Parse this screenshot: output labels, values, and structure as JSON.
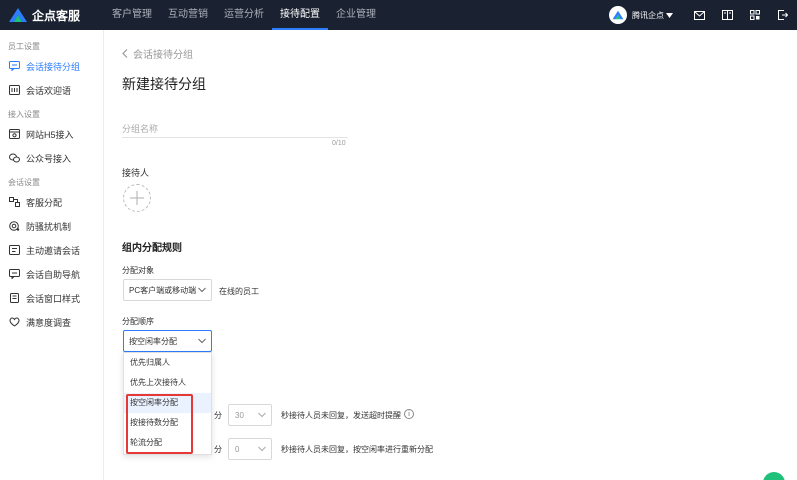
{
  "brand": {
    "name": "企点客服"
  },
  "nav": [
    {
      "label": "客户管理"
    },
    {
      "label": "互动营销"
    },
    {
      "label": "运营分析"
    },
    {
      "label": "接待配置",
      "active": true
    },
    {
      "label": "企业管理"
    }
  ],
  "user": {
    "name": "腾讯企点"
  },
  "top_icons": [
    "mail-icon",
    "book-icon",
    "grid-icon",
    "logout-icon"
  ],
  "sidebar": {
    "groups": [
      {
        "title": "员工设置",
        "items": [
          {
            "label": "会话接待分组",
            "icon": "chat-group-icon",
            "active": true
          },
          {
            "label": "会话欢迎语",
            "icon": "welcome-icon"
          }
        ]
      },
      {
        "title": "接入设置",
        "items": [
          {
            "label": "网站H5接入",
            "icon": "web-icon"
          },
          {
            "label": "公众号接入",
            "icon": "wechat-icon"
          }
        ]
      },
      {
        "title": "会话设置",
        "items": [
          {
            "label": "客服分配",
            "icon": "assign-icon"
          },
          {
            "label": "防骚扰机制",
            "icon": "shield-icon"
          },
          {
            "label": "主动邀请会话",
            "icon": "invite-icon"
          },
          {
            "label": "会话自助导航",
            "icon": "nav-icon"
          },
          {
            "label": "会话窗口样式",
            "icon": "window-icon"
          },
          {
            "label": "满意度调查",
            "icon": "survey-icon"
          }
        ]
      }
    ]
  },
  "main": {
    "breadcrumb": "会话接待分组",
    "title": "新建接待分组",
    "name_placeholder": "分组名称",
    "name_counter": "0/10",
    "receptionist_label": "接待人",
    "rules_title": "组内分配规则",
    "target_label": "分配对象",
    "target_value": "PC客户端或移动端",
    "target_suffix": "在线的员工",
    "order_label": "分配顺序",
    "order_value": "按空闲率分配",
    "order_options": [
      "优先归属人",
      "优先上次接待人",
      "按空闲率分配",
      "按接待数分配",
      "轮流分配"
    ],
    "row1": {
      "unit": "分",
      "value": "30",
      "text": "秒接待人员未回复，发送超时提醒"
    },
    "row2": {
      "unit": "分",
      "value": "0",
      "text": "秒接待人员未回复，按空闲率进行重新分配"
    }
  },
  "colors": {
    "accent": "#2d7dfc",
    "topbar": "#1a2130",
    "highlight": "#e53935",
    "float": "#1ec07a"
  }
}
